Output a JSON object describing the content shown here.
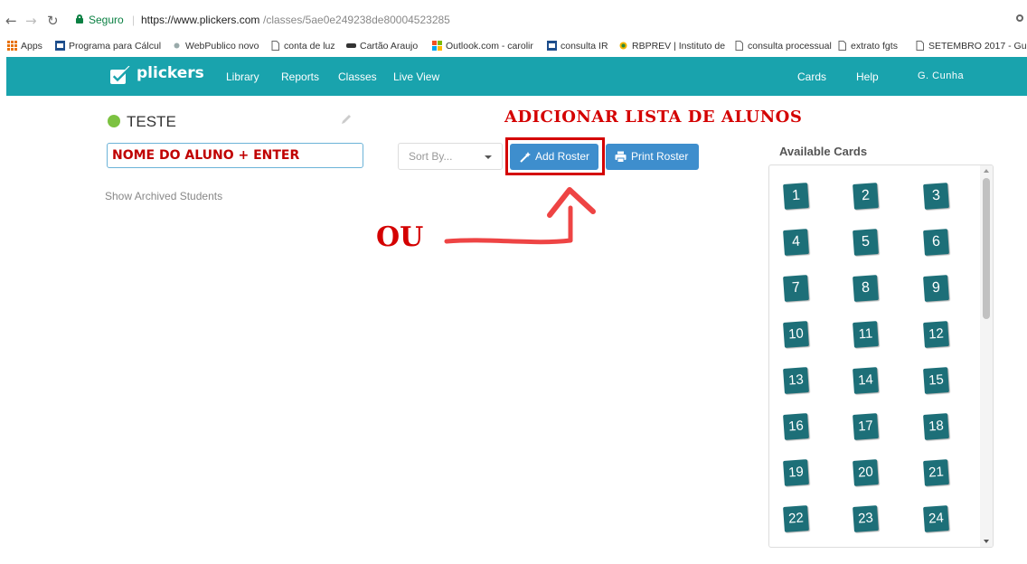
{
  "browser": {
    "secure_label": "Seguro",
    "url_host": "https://www.plickers.com",
    "url_path": "/classes/5ae0e249238de80004523285",
    "bookmarks": [
      {
        "label": "Apps",
        "icon": "apps-grid-icon"
      },
      {
        "label": "Programa para Cálcul",
        "icon": "gov-icon"
      },
      {
        "label": "WebPublico novo",
        "icon": "web-icon"
      },
      {
        "label": "conta de luz",
        "icon": "page-icon"
      },
      {
        "label": "Cartão Araujo",
        "icon": "card-icon"
      },
      {
        "label": "Outlook.com - carolir",
        "icon": "microsoft-icon"
      },
      {
        "label": "consulta IR",
        "icon": "gov-icon"
      },
      {
        "label": "RBPREV | Instituto de",
        "icon": "rbprev-icon"
      },
      {
        "label": "consulta processual",
        "icon": "page-icon"
      },
      {
        "label": "extrato fgts",
        "icon": "page-icon"
      },
      {
        "label": "SETEMBRO 2017 - Gu",
        "icon": "page-icon"
      }
    ]
  },
  "header": {
    "brand": "plickers",
    "nav": [
      "Library",
      "Reports",
      "Classes",
      "Live View"
    ],
    "right": [
      "Cards",
      "Help",
      "G. Cunha"
    ]
  },
  "class": {
    "name": "TESTE",
    "student_input_value": "NOME DO ALUNO + ENTER",
    "archived_link": "Show Archived Students",
    "sort_placeholder": "Sort By...",
    "add_roster": "Add Roster",
    "print_roster": "Print Roster"
  },
  "annotations": {
    "title": "ADICIONAR LISTA DE ALUNOS",
    "or": "OU"
  },
  "cards": {
    "heading": "Available Cards",
    "numbers": [
      "1",
      "2",
      "3",
      "4",
      "5",
      "6",
      "7",
      "8",
      "9",
      "10",
      "11",
      "12",
      "13",
      "14",
      "15",
      "16",
      "17",
      "18",
      "19",
      "20",
      "21",
      "22",
      "23",
      "24"
    ]
  },
  "colors": {
    "brand": "#19a3ad",
    "button": "#3e8ecd",
    "card": "#1d6f78",
    "annotation": "#d40000",
    "status_dot": "#7cc241"
  }
}
